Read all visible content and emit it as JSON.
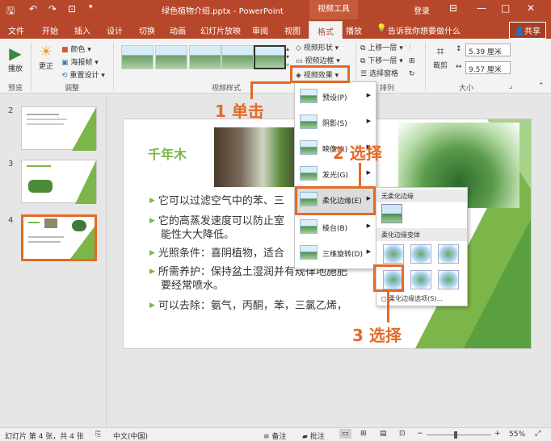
{
  "titlebar": {
    "filename": "绿色植物介绍.pptx - PowerPoint",
    "context_tab": "视频工具",
    "login": "登录",
    "win_min": "—",
    "win_restore": "□",
    "win_close": "✕"
  },
  "tabs": {
    "file": "文件",
    "home": "开始",
    "insert": "插入",
    "design": "设计",
    "transitions": "切换",
    "animations": "动画",
    "slideshow": "幻灯片放映",
    "review": "审阅",
    "view": "视图",
    "format": "格式",
    "playback": "播放",
    "tellme": "告诉我你想要做什么",
    "share": "共享"
  },
  "ribbon": {
    "play_label": "播放",
    "correct_label": "更正",
    "color_label": "颜色",
    "poster_label": "海报帧",
    "reset_label": "重置设计",
    "group_preview": "预览",
    "group_adjust": "调整",
    "group_styles": "视频样式",
    "shape_label": "视频形状",
    "border_label": "视频边框",
    "effects_label": "视频效果",
    "bring_fwd": "上移一层",
    "send_back": "下移一层",
    "selection_pane": "选择窗格",
    "group_arrange": "排列",
    "crop_label": "裁剪",
    "height_value": "5.39 厘米",
    "width_value": "9.57 厘米",
    "group_size": "大小"
  },
  "thumbs": [
    {
      "num": "2"
    },
    {
      "num": "3"
    },
    {
      "num": "4"
    }
  ],
  "slide": {
    "title": "千年木",
    "bullets": [
      {
        "text": "它可以过滤空气中的苯、三",
        "cont": ""
      },
      {
        "text": "它的高蒸发速度可以防止室",
        "cont": "能性大大降低。"
      },
      {
        "text": "光照条件：喜阴植物，适合",
        "cont": ""
      },
      {
        "text": "所需养护：保持盆土湿润并有规律地施肥",
        "cont": "要经常喷水。"
      },
      {
        "text": "可以去除：氨气，丙酮，苯，三氯乙烯，",
        "cont": ""
      }
    ]
  },
  "menu": {
    "items": [
      {
        "label": "预设(P)"
      },
      {
        "label": "阴影(S)"
      },
      {
        "label": "映像(R)"
      },
      {
        "label": "发光(G)"
      },
      {
        "label": "柔化边缘(E)"
      },
      {
        "label": "棱台(B)"
      },
      {
        "label": "三维旋转(D)"
      }
    ]
  },
  "submenu": {
    "no_soft_header": "无柔化边缘",
    "variant_header": "柔化边缘变体",
    "options_label": "柔化边缘选项(S)..."
  },
  "annotations": {
    "step1": "1 单击",
    "step2": "2 选择",
    "step3": "3 选择"
  },
  "statusbar": {
    "slide_info": "幻灯片 第 4 张，共 4 张",
    "language": "中文(中国)",
    "notes": "备注",
    "comments": "批注",
    "zoom": "55%"
  },
  "colors": {
    "accent": "#b7472a",
    "annotation": "#e36a28",
    "bullet": "#7cb64a"
  }
}
